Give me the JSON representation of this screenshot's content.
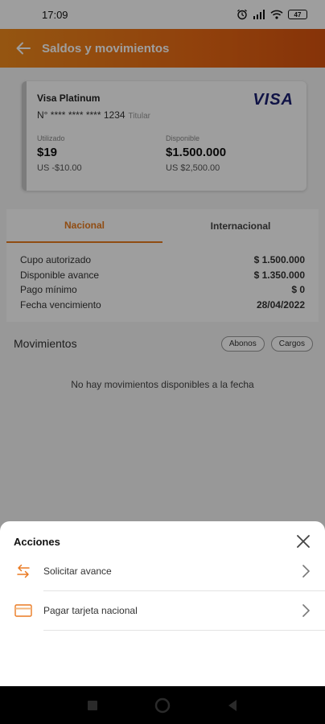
{
  "status_bar": {
    "time": "17:09",
    "battery": "47"
  },
  "header": {
    "title": "Saldos y movimientos"
  },
  "card": {
    "name": "Visa Platinum",
    "number": "N° **** **** **** 1234",
    "holder": "Titular",
    "brand": "VISA",
    "used_label": "Utilizado",
    "used_value": "$19",
    "used_usd": "US -$10.00",
    "available_label": "Disponible",
    "available_value": "$1.500.000",
    "available_usd": "US $2,500.00"
  },
  "tabs": [
    {
      "label": "Nacional",
      "active": true
    },
    {
      "label": "Internacional",
      "active": false
    }
  ],
  "details": [
    {
      "label": "Cupo autorizado",
      "value": "$ 1.500.000"
    },
    {
      "label": "Disponible avance",
      "value": "$ 1.350.000"
    },
    {
      "label": "Pago mínimo",
      "value": "$ 0"
    },
    {
      "label": "Fecha vencimiento",
      "value": "28/04/2022"
    }
  ],
  "movements": {
    "label": "Movimientos",
    "filters": [
      "Abonos",
      "Cargos"
    ],
    "empty_text": "No hay movimientos disponibles a la fecha"
  },
  "sheet": {
    "title": "Acciones",
    "actions": [
      {
        "label": "Solicitar avance",
        "icon": "transfer-arrows-icon"
      },
      {
        "label": "Pagar tarjeta nacional",
        "icon": "credit-card-icon"
      }
    ]
  },
  "colors": {
    "accent": "#e87b1e",
    "header_start": "#f08a1c",
    "header_end": "#d9530f",
    "visa_blue": "#1a1f71"
  }
}
